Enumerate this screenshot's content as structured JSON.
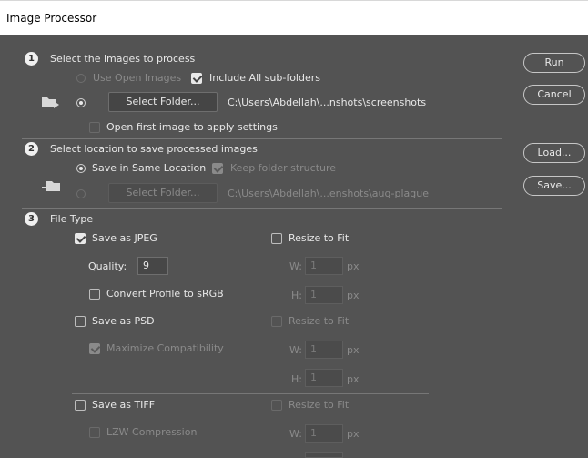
{
  "window": {
    "title": "Image Processor"
  },
  "section1": {
    "number": "1",
    "heading": "Select the images to process",
    "use_open_images": "Use Open Images",
    "include_subfolders": "Include All sub-folders",
    "select_folder_button": "Select Folder...",
    "source_path": "C:\\Users\\Abdellah\\...nshots\\screenshots",
    "open_first_image": "Open first image to apply settings"
  },
  "section2": {
    "number": "2",
    "heading": "Select location to save processed images",
    "save_same_location": "Save in Same Location",
    "keep_structure": "Keep folder structure",
    "select_folder_button": "Select Folder...",
    "dest_path": "C:\\Users\\Abdellah\\...enshots\\aug-plague"
  },
  "section3": {
    "number": "3",
    "heading": "File Type",
    "jpeg": {
      "label": "Save as JPEG",
      "resize_label": "Resize to Fit",
      "quality_label": "Quality:",
      "quality_value": "9",
      "convert_label": "Convert Profile to sRGB",
      "w_label": "W:",
      "w_value": "1",
      "h_label": "H:",
      "h_value": "1",
      "unit": "px"
    },
    "psd": {
      "label": "Save as PSD",
      "resize_label": "Resize to Fit",
      "maximize_label": "Maximize Compatibility",
      "w_label": "W:",
      "w_value": "1",
      "h_label": "H:",
      "h_value": "1",
      "unit": "px"
    },
    "tiff": {
      "label": "Save as TIFF",
      "resize_label": "Resize to Fit",
      "lzw_label": "LZW Compression",
      "w_label": "W:",
      "w_value": "1",
      "unit": "px"
    }
  },
  "buttons": {
    "run": "Run",
    "cancel": "Cancel",
    "load": "Load...",
    "save": "Save..."
  },
  "colors": {
    "panel_bg": "#535353",
    "title_bg": "#ffffff",
    "text": "#e8e8e8",
    "disabled_text": "#8a8a8a"
  }
}
